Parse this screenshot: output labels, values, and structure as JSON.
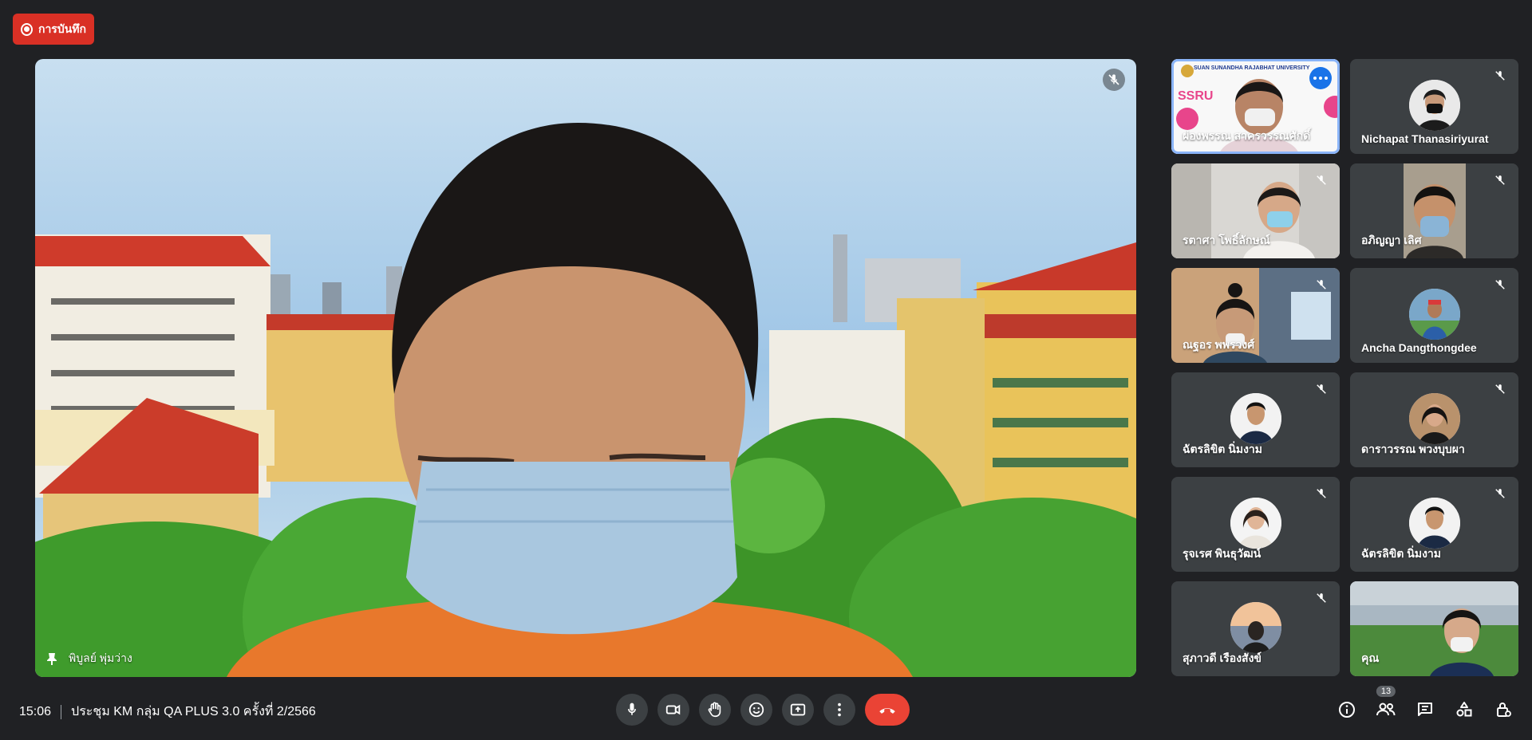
{
  "recording": {
    "label": "การบันทึก",
    "color": "#d93025"
  },
  "main_speaker": {
    "name": "พิบูลย์ พุ่มว่าง",
    "muted": true,
    "pinned": true
  },
  "participants": [
    {
      "name": "ผ่องพรรณ สาคร...",
      "display": "ผ่องพรรณ สาครวรรณศักดิ์",
      "type": "video",
      "active": true,
      "banner": "SUAN SUNANDHA RAJABHAT UNIVERSITY",
      "logo": "SSRU"
    },
    {
      "name": "Nichapat Thanasiriyurat",
      "display": "Nichapat Thanasiriyurat",
      "type": "avatar",
      "muted": true
    },
    {
      "name": "รตาศา",
      "display": "รตาศา โพธิ์ลักษณ์",
      "type": "video",
      "muted": true
    },
    {
      "name": "อภิญญา",
      "display": "อภิญญา เลิศ",
      "type": "video",
      "muted": true
    },
    {
      "name": "ณฐอร",
      "display": "ณฐอร พพรวงศ์",
      "type": "video",
      "muted": true
    },
    {
      "name": "Ancha Dangthongdee",
      "display": "Ancha Dangthongdee",
      "type": "avatar",
      "muted": true
    },
    {
      "name": "ฉัตรลิขิต นิ่มงาม",
      "display": "ฉัตรลิขิต นิ่มงาม",
      "type": "avatar",
      "muted": true
    },
    {
      "name": "ดาราวรรณ พวงบุบผา",
      "display": "ดาราวรรณ พวงบุบผา",
      "type": "avatar",
      "muted": true
    },
    {
      "name": "รุจเรศ พันธุวัฒน์",
      "display": "รุจเรศ พินธุวัฒน์",
      "type": "avatar",
      "muted": true
    },
    {
      "name": "ฉัตรลิขิต นิ่มงาม 2",
      "display": "ฉัตรลิขิต นิ่มงาม",
      "type": "avatar",
      "muted": true
    },
    {
      "name": "สุภาวดี เรืองสังข์",
      "display": "สุภาวดี เรืองสังข์",
      "type": "avatar",
      "muted": true
    },
    {
      "name": "คุณ",
      "display": "คุณ",
      "type": "video",
      "muted": false
    }
  ],
  "bottom_bar": {
    "time": "15:06",
    "meeting_title": "ประชุม KM กลุ่ม QA PLUS 3.0 ครั้งที่ 2/2566",
    "controls": [
      "mic-icon",
      "camera-icon",
      "raise-hand-icon",
      "emoji-icon",
      "present-icon",
      "more-options-icon",
      "end-call-icon"
    ],
    "people_count": "13",
    "right_icons": [
      "info-icon",
      "people-icon",
      "chat-icon",
      "activities-icon",
      "host-controls-icon"
    ]
  },
  "colors": {
    "background": "#202124",
    "tile": "#3c4043",
    "accent": "#8ab4f8",
    "end_call": "#ea4335"
  }
}
